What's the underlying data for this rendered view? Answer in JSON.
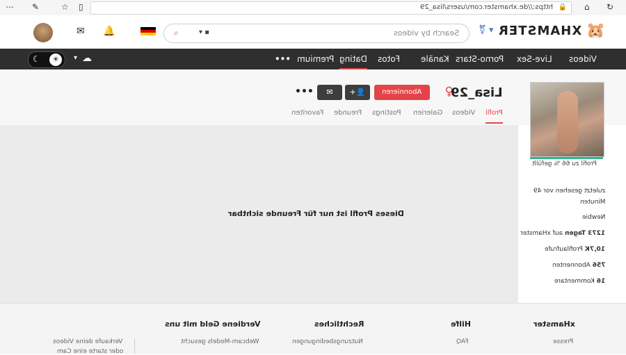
{
  "browser": {
    "url": "https://de.xhamster.com/users/lisa_29",
    "nav_icons": [
      "home-icon",
      "refresh-icon",
      "back-icon"
    ],
    "tool_icons": [
      "settings-icon",
      "pen-icon",
      "star-icon",
      "reader-icon"
    ]
  },
  "header": {
    "logo_text": "XHAMSTER",
    "search_placeholder": "Search by videos",
    "language_flag": "de-flag",
    "avatar_icon": "user-avatar"
  },
  "nav": {
    "items": [
      "Videos",
      "Live-Sex",
      "Porno-Stars",
      "Kanäle",
      "Fotos",
      "Dating",
      "Premium"
    ],
    "active": "Dating",
    "more": "•••"
  },
  "profile": {
    "username": "Lisa_29",
    "gender_symbol": "♀",
    "subscribe_label": "Abonnieren",
    "more": "•••",
    "tabs": [
      "Profil",
      "Videos",
      "Galerien",
      "Postings",
      "Freunde",
      "Favoriten"
    ],
    "active_tab": "Profil",
    "completion": "Profil zu 66 % gefüllt",
    "private_message": "Dieses Profil ist nur für Freunde sichtbar"
  },
  "stats": {
    "last_seen_line1": "zuletzt gesehen vor 49",
    "last_seen_line2": "Minuten",
    "level": "Newbie",
    "days_value": "1273 Tagen",
    "days_suffix": "auf xHamster",
    "views_value": "10,7K",
    "views_suffix": "Profilaufrufe",
    "subs_value": "756",
    "subs_suffix": "Abonnenten",
    "comments_value": "16",
    "comments_suffix": "Kommentare"
  },
  "footer": {
    "columns": [
      {
        "title": "xHamster",
        "item": "Presse"
      },
      {
        "title": "Hilfe",
        "item": "FAQ"
      },
      {
        "title": "Rechtliches",
        "item": "Nutzungsbedingungen"
      },
      {
        "title": "Verdiene Geld mit uns",
        "item": "Webcam-Models gesucht"
      }
    ],
    "promo_line1": "Verkaufe deine Videos",
    "promo_line2": "oder starte eine Cam"
  },
  "colors": {
    "accent": "#e34449",
    "nav_bg": "#2f2f2f",
    "progress": "#2fb68d"
  }
}
